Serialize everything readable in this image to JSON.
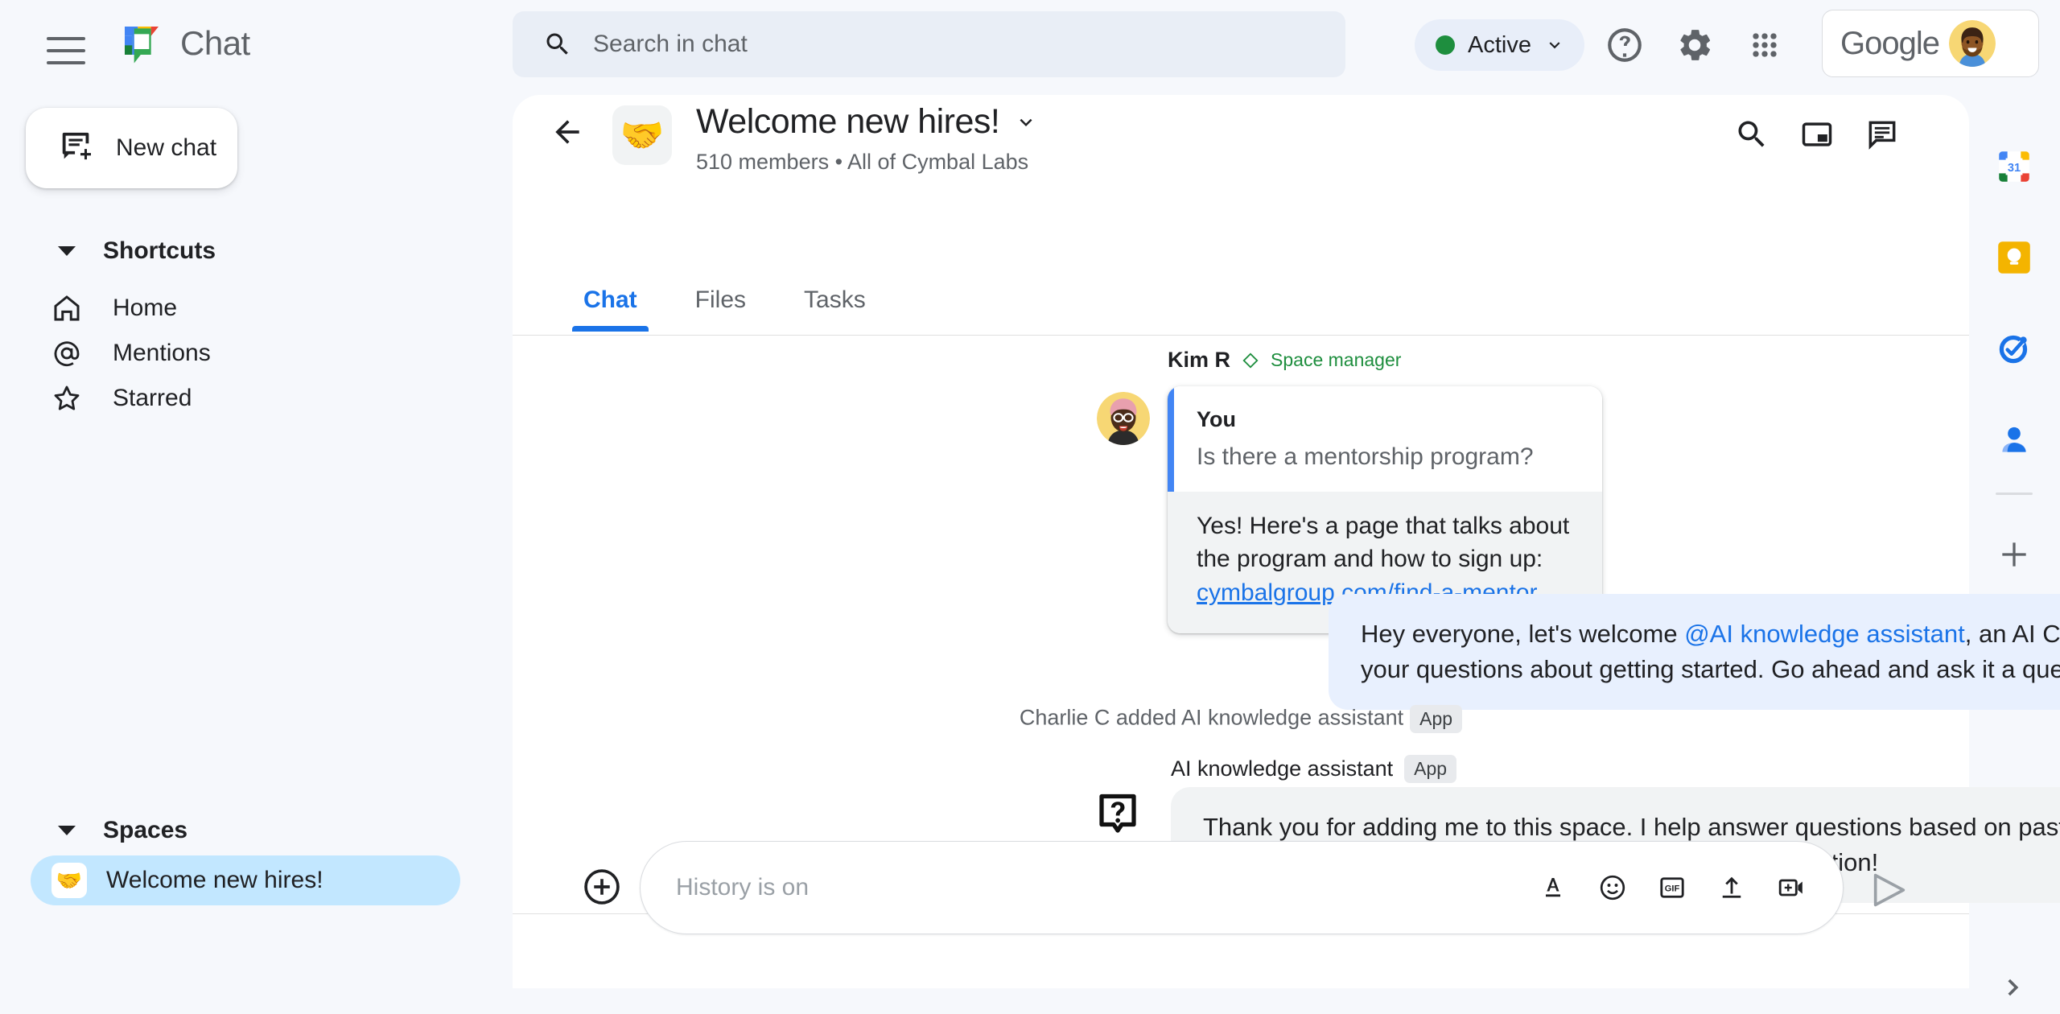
{
  "app": {
    "brand_name": "Chat",
    "google_word": "Google"
  },
  "topbar": {
    "menu_icon": "hamburger-icon",
    "logo_icon": "google-chat-logo",
    "search": {
      "icon": "search-icon",
      "placeholder": "Search in chat",
      "value": ""
    },
    "status": {
      "label": "Active",
      "dot_color": "#1e8e3e",
      "chevron_icon": "chevron-down-icon"
    },
    "help_icon": "help-circle-icon",
    "settings_icon": "gear-icon",
    "apps_icon": "apps-grid-icon",
    "avatar_icon": "user-avatar"
  },
  "sidebar": {
    "new_chat": {
      "label": "New chat",
      "icon": "new-chat-icon"
    },
    "shortcuts": {
      "header": "Shortcuts",
      "caret_icon": "caret-down-icon",
      "items": [
        {
          "label": "Home",
          "icon": "home-icon"
        },
        {
          "label": "Mentions",
          "icon": "at-sign-icon"
        },
        {
          "label": "Starred",
          "icon": "star-icon"
        }
      ]
    },
    "spaces": {
      "header": "Spaces",
      "caret_icon": "caret-down-icon",
      "items": [
        {
          "label": "Welcome new hires!",
          "emoji": "🤝",
          "selected": true
        }
      ]
    }
  },
  "space": {
    "back_icon": "back-arrow-icon",
    "emoji": "🤝",
    "title": "Welcome new hires!",
    "title_chevron_icon": "chevron-down-icon",
    "members_count": "510 members",
    "separator": "•",
    "org": "All of Cymbal Labs",
    "subtitle": "510 members  •  All of Cymbal Labs",
    "header_icons": [
      {
        "name": "search-icon"
      },
      {
        "name": "picture-in-picture-icon"
      },
      {
        "name": "thread-panel-icon"
      }
    ],
    "tabs": [
      {
        "label": "Chat",
        "active": true
      },
      {
        "label": "Files",
        "active": false
      },
      {
        "label": "Tasks",
        "active": false
      }
    ]
  },
  "messages": {
    "kim": {
      "sender_name": "Kim R",
      "role_icon": "diamond-icon",
      "role_label": "Space manager",
      "avatar_icon": "kim-avatar",
      "quote": {
        "author": "You",
        "text": "Is there a mentorship program?"
      },
      "body_text": "Yes! Here's a page that talks about the program and how to sign up: ",
      "link_text": "cymbalgroup.com/find-a-mentor"
    },
    "welcome_bubble": {
      "text_before": "Hey everyone, let's welcome ",
      "mention": "@AI knowledge assistant",
      "text_after": ", an AI Chat app that will answer your questions about getting started.  Go ahead and ask it a question!"
    },
    "system_event": {
      "text": "Charlie C added AI knowledge assistant",
      "badge": "App"
    },
    "assistant": {
      "sender_name": "AI knowledge assistant",
      "badge": "App",
      "avatar_icon": "question-mark-app-icon",
      "body_text": "Thank you for adding me to this space. I help answer questions based on past conversation in this space. Go ahead and ask me a question!"
    }
  },
  "composer": {
    "plus_icon": "add-circle-icon",
    "placeholder": "History is on",
    "value": "",
    "icons": [
      {
        "name": "format-text-icon"
      },
      {
        "name": "emoji-icon"
      },
      {
        "name": "gif-icon"
      },
      {
        "name": "upload-icon"
      },
      {
        "name": "video-add-icon"
      }
    ],
    "send_icon": "send-icon"
  },
  "right_rail": {
    "items": [
      {
        "name": "google-calendar-icon",
        "label": "31"
      },
      {
        "name": "google-keep-icon",
        "label": ""
      },
      {
        "name": "google-tasks-icon",
        "label": ""
      },
      {
        "name": "google-contacts-icon",
        "label": ""
      }
    ],
    "add_icon": "plus-icon",
    "expand_icon": "chevron-right-icon"
  },
  "colors": {
    "page_bg": "#f6f8fc",
    "panel_bg": "#ffffff",
    "accent_blue": "#1a73e8",
    "bubble_blue": "#e8f0fe",
    "bubble_gray": "#f1f3f4",
    "selected_space": "#c2e7ff",
    "active_green": "#1e8e3e"
  }
}
